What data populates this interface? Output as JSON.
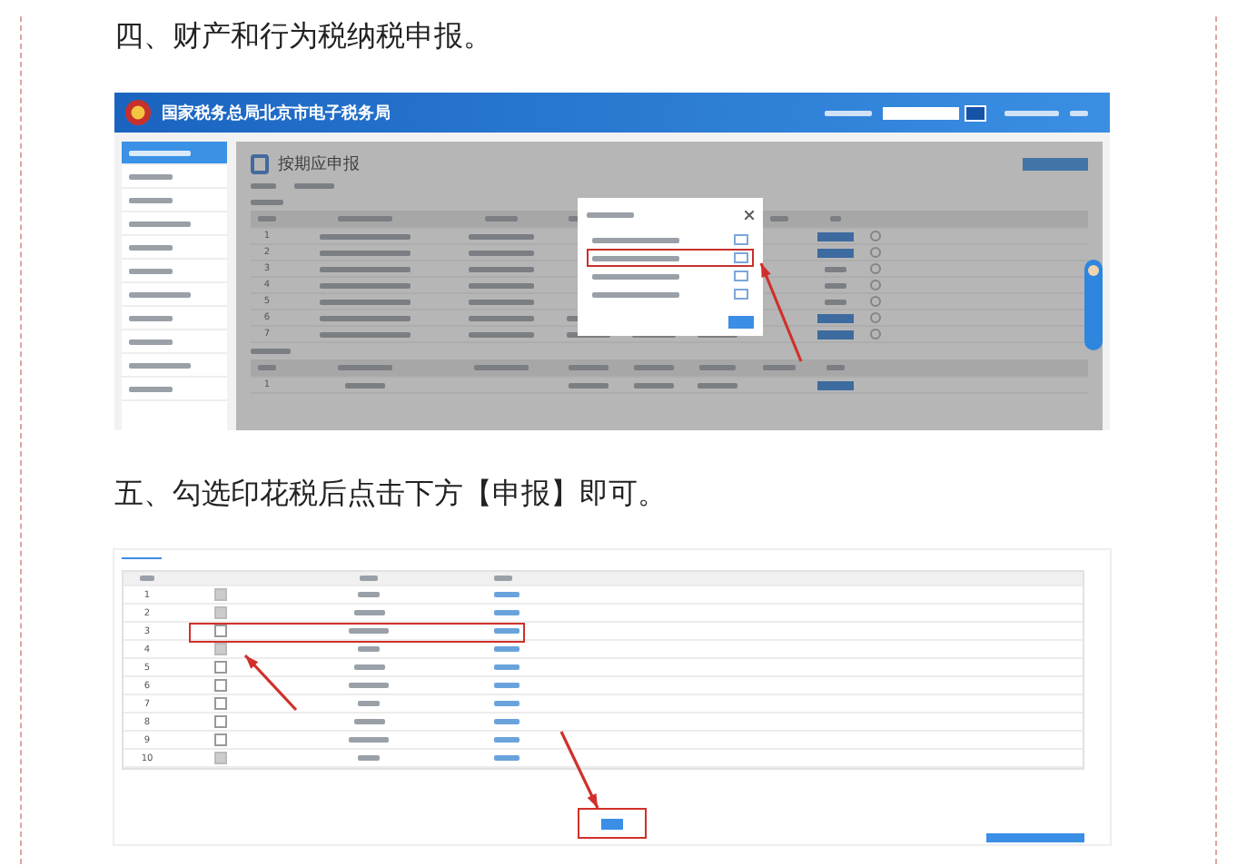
{
  "article": {
    "steps": [
      {
        "kind": "portal",
        "heading": "四、财产和行为税纳税申报。",
        "screenshot": {
          "site_title": "国家税务总局北京市电子税务局",
          "page_title": "按期应申报",
          "sidebar_items": [
            {
              "selected": true
            },
            {
              "selected": false
            },
            {
              "selected": false
            },
            {
              "selected": false
            },
            {
              "selected": false
            },
            {
              "selected": false
            },
            {
              "selected": false
            },
            {
              "selected": false
            },
            {
              "selected": false
            },
            {
              "selected": false
            },
            {
              "selected": false
            }
          ],
          "rows": [
            {
              "number": "1"
            },
            {
              "number": "2"
            },
            {
              "number": "3"
            },
            {
              "number": "4"
            },
            {
              "number": "5"
            },
            {
              "number": "6"
            },
            {
              "number": "7"
            }
          ],
          "lower_rows": [
            {
              "number": "1"
            }
          ],
          "dialog_options": [
            {
              "selected": false
            },
            {
              "selected": true
            },
            {
              "selected": false
            },
            {
              "selected": false
            }
          ]
        }
      },
      {
        "kind": "stamp",
        "heading": "五、勾选印花税后点击下方【申报】即可。",
        "screenshot": {
          "rows": [
            {
              "number": "1",
              "checked": true,
              "selected": false
            },
            {
              "number": "2",
              "checked": true,
              "selected": false
            },
            {
              "number": "3",
              "checked": false,
              "selected": true
            },
            {
              "number": "4",
              "checked": true,
              "selected": false
            },
            {
              "number": "5",
              "checked": false,
              "selected": false
            },
            {
              "number": "6",
              "checked": false,
              "selected": false
            },
            {
              "number": "7",
              "checked": false,
              "selected": false
            },
            {
              "number": "8",
              "checked": false,
              "selected": false
            },
            {
              "number": "9",
              "checked": false,
              "selected": false
            },
            {
              "number": "10",
              "checked": true,
              "selected": false
            }
          ]
        }
      }
    ]
  }
}
